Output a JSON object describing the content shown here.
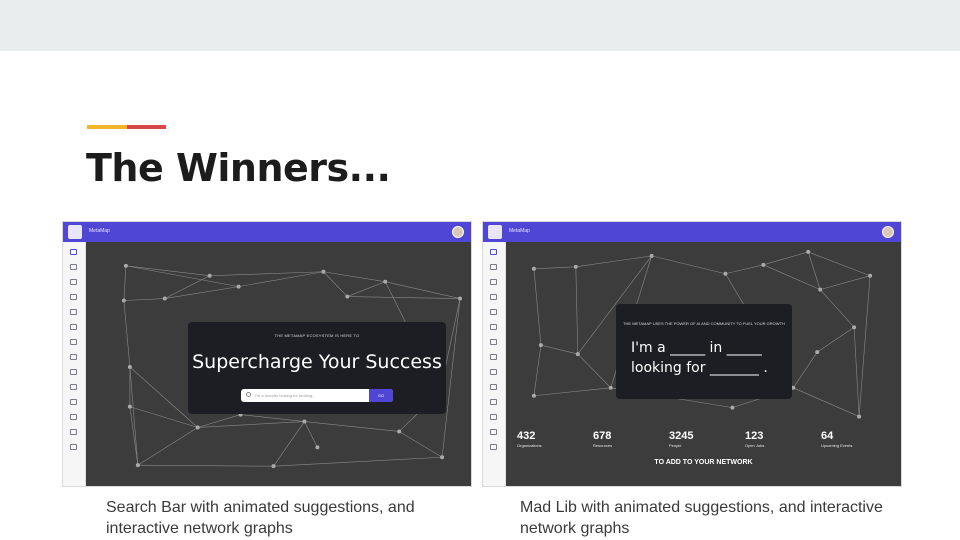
{
  "slide": {
    "title": "The Winners...",
    "accent_colors": [
      "#f2b62b",
      "#d94848"
    ]
  },
  "screenshot_left": {
    "app_name": "MetaMap",
    "kicker": "THE METAMAP ECOSYSTEM IS HERE TO",
    "headline": "Supercharge Your Success",
    "search_placeholder": "I'm a founder looking for funding...",
    "search_button": "GO",
    "accent": "#5046d6"
  },
  "screenshot_right": {
    "app_name": "MetaMap",
    "kicker": "THE METAMAP USES THE POWER OF AI AND COMMUNITY TO FUEL YOUR GROWTH",
    "madlib_line1": "I'm a _____ in _____",
    "madlib_line2": "looking for _______ .",
    "stats": [
      {
        "value": "432",
        "label": "Organizations"
      },
      {
        "value": "678",
        "label": "Resources"
      },
      {
        "value": "3245",
        "label": "People"
      },
      {
        "value": "123",
        "label": "Open Jobs"
      },
      {
        "value": "64",
        "label": "Upcoming Events"
      }
    ],
    "cta": "TO ADD TO YOUR NETWORK"
  },
  "captions": {
    "left": "Search Bar with animated suggestions, and interactive network graphs",
    "right": "Mad Lib  with animated suggestions, and interactive network graphs"
  }
}
